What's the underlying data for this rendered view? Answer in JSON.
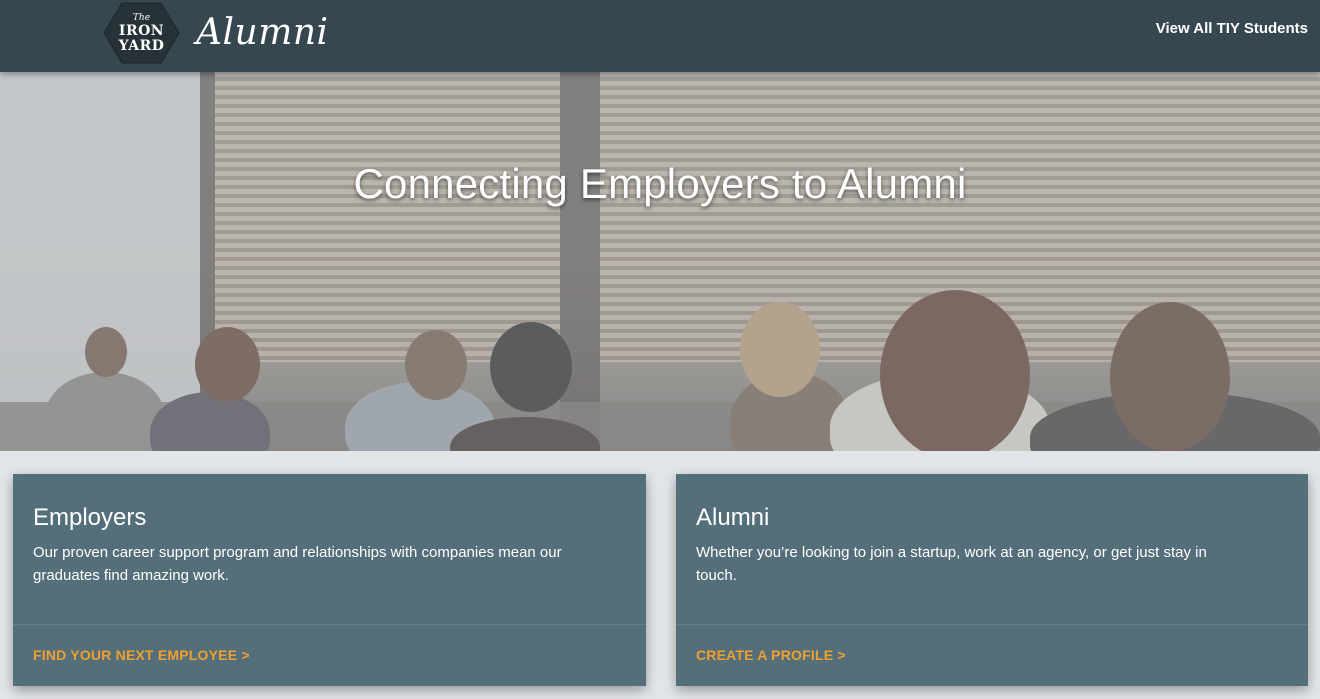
{
  "navbar": {
    "logo": {
      "line1": "The",
      "line2": "IRON",
      "line3": "YARD"
    },
    "brand": "Alumni",
    "link_label": "View All TIY Students"
  },
  "hero": {
    "title": "Connecting Employers to Alumni"
  },
  "cards": [
    {
      "title": "Employers",
      "text": "Our proven career support program and relationships with companies mean our graduates find amazing work.",
      "link": "FIND YOUR NEXT EMPLOYEE >"
    },
    {
      "title": "Alumni",
      "text": "Whether you’re looking to join a startup, work at an agency, or get just stay in touch.",
      "link": "CREATE A PROFILE >"
    }
  ],
  "colors": {
    "navbar_bg": "#37474f",
    "card_bg": "#546e7a",
    "link_accent": "#f0a030",
    "page_bg": "#e3e6e9"
  }
}
